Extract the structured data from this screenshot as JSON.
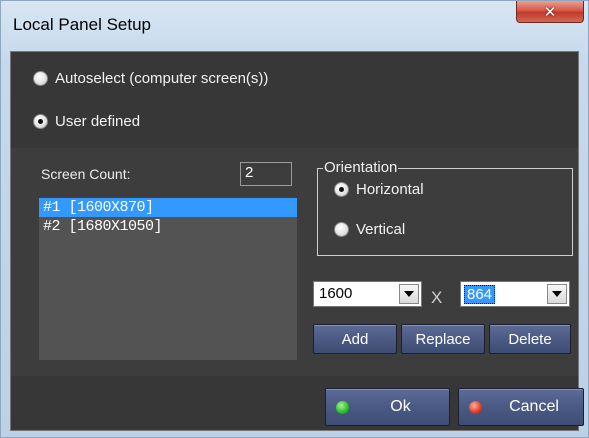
{
  "window": {
    "title": "Local Panel Setup"
  },
  "mode": {
    "autoselect_label": "Autoselect (computer screen(s))",
    "user_defined_label": "User defined",
    "selected": "user_defined"
  },
  "screens": {
    "count_label": "Screen Count:",
    "count_value": "2",
    "items": [
      {
        "label": "#1 [1600X870]",
        "selected": true
      },
      {
        "label": "#2 [1680X1050]",
        "selected": false
      }
    ]
  },
  "orientation": {
    "legend": "Orientation",
    "horizontal_label": "Horizontal",
    "vertical_label": "Vertical",
    "selected": "horizontal"
  },
  "resolution": {
    "width_value": "1600",
    "separator": "X",
    "height_value": "864"
  },
  "actions": {
    "add_label": "Add",
    "replace_label": "Replace",
    "delete_label": "Delete"
  },
  "footer": {
    "ok_label": "Ok",
    "cancel_label": "Cancel"
  },
  "icons": {
    "close": "close-icon",
    "ok_led": "green-led-icon",
    "cancel_led": "red-led-icon"
  }
}
